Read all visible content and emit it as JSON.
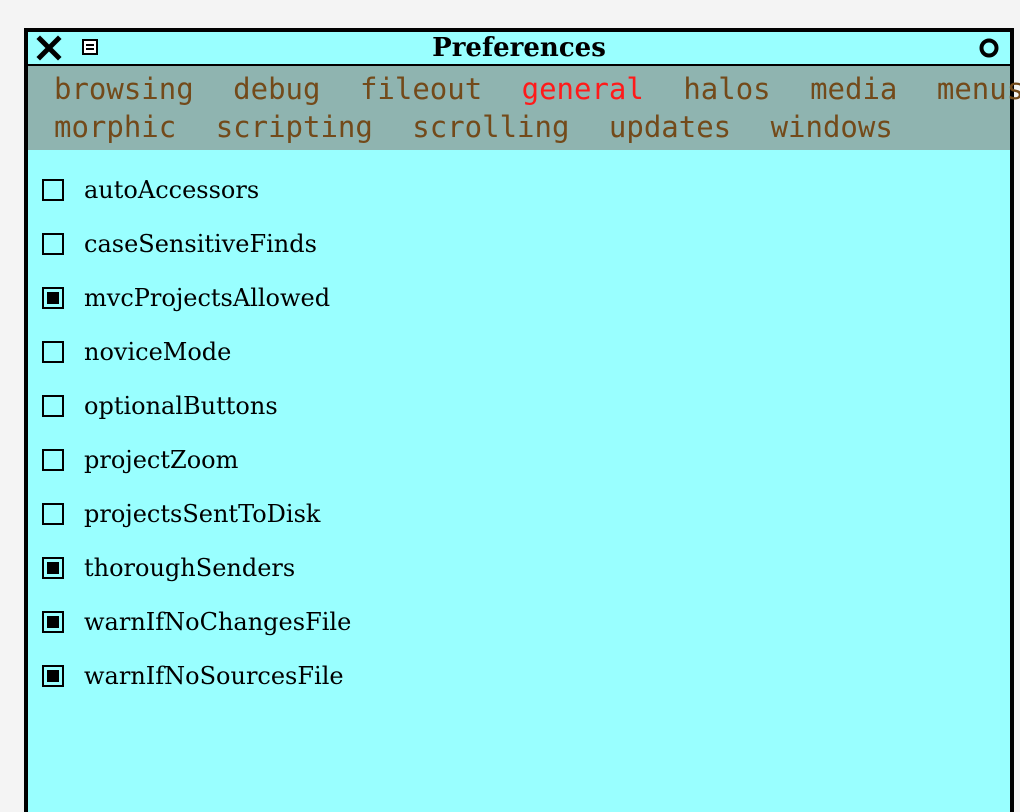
{
  "window": {
    "title": "Preferences",
    "close_icon": "close-x-icon",
    "collapse_icon": "collapse-icon",
    "menu_icon": "window-menu-circle-icon"
  },
  "tabs": {
    "row1": [
      "browsing",
      "debug",
      "fileout",
      "general",
      "halos",
      "media",
      "menus"
    ],
    "row2": [
      "morphic",
      "scripting",
      "scrolling",
      "updates",
      "windows"
    ],
    "active": "general",
    "colors": {
      "tab_text": "#734a1a",
      "active_tab_text": "#ff1a1a",
      "tab_bar_background": "#8fb4b0"
    }
  },
  "preferences": [
    {
      "label": "autoAccessors",
      "checked": false
    },
    {
      "label": "caseSensitiveFinds",
      "checked": false
    },
    {
      "label": "mvcProjectsAllowed",
      "checked": true
    },
    {
      "label": "noviceMode",
      "checked": false
    },
    {
      "label": "optionalButtons",
      "checked": false
    },
    {
      "label": "projectZoom",
      "checked": false
    },
    {
      "label": "projectsSentToDisk",
      "checked": false
    },
    {
      "label": "thoroughSenders",
      "checked": true
    },
    {
      "label": "warnIfNoChangesFile",
      "checked": true
    },
    {
      "label": "warnIfNoSourcesFile",
      "checked": true
    }
  ],
  "colors": {
    "window_background": "#99ffff"
  }
}
